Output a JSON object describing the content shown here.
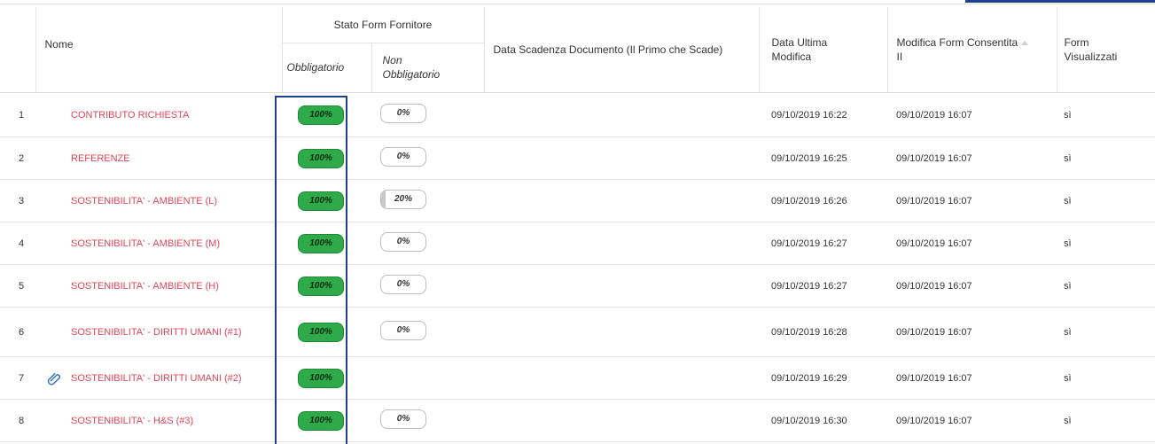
{
  "header": {
    "nome": "Nome",
    "stato_group": "Stato Form Fornitore",
    "obbligatorio": "Obbligatorio",
    "non_obbligatorio": "Non Obbligatorio",
    "data_scadenza": "Data Scadenza Documento (Il Primo che Scade)",
    "data_ultima": "Data Ultima Modifica",
    "modifica_consentita": "Modifica Form Consentita",
    "modifica_consentita_suffix": "II",
    "form_visualizzati": "Form Visualizzati"
  },
  "rows": [
    {
      "index": "1",
      "name": "CONTRIBUTO RICHIESTA",
      "obbligatorio": "100%",
      "obbligatorio_pct": 100,
      "non_obbligatorio": "0%",
      "non_obbligatorio_pct": 0,
      "scadenza": "",
      "ultima_modifica": "09/10/2019 16:22",
      "modifica_consentita": "09/10/2019 16:07",
      "visualizzati": "sì",
      "icon": ""
    },
    {
      "index": "2",
      "name": "REFERENZE",
      "obbligatorio": "100%",
      "obbligatorio_pct": 100,
      "non_obbligatorio": "0%",
      "non_obbligatorio_pct": 0,
      "scadenza": "",
      "ultima_modifica": "09/10/2019 16:25",
      "modifica_consentita": "09/10/2019 16:07",
      "visualizzati": "sì",
      "icon": ""
    },
    {
      "index": "3",
      "name": "SOSTENIBILITA' - AMBIENTE (L)",
      "obbligatorio": "100%",
      "obbligatorio_pct": 100,
      "non_obbligatorio": "20%",
      "non_obbligatorio_pct": 20,
      "scadenza": "",
      "ultima_modifica": "09/10/2019 16:26",
      "modifica_consentita": "09/10/2019 16:07",
      "visualizzati": "sì",
      "icon": ""
    },
    {
      "index": "4",
      "name": "SOSTENIBILITA' - AMBIENTE (M)",
      "obbligatorio": "100%",
      "obbligatorio_pct": 100,
      "non_obbligatorio": "0%",
      "non_obbligatorio_pct": 0,
      "scadenza": "",
      "ultima_modifica": "09/10/2019 16:27",
      "modifica_consentita": "09/10/2019 16:07",
      "visualizzati": "sì",
      "icon": ""
    },
    {
      "index": "5",
      "name": "SOSTENIBILITA' - AMBIENTE (H)",
      "obbligatorio": "100%",
      "obbligatorio_pct": 100,
      "non_obbligatorio": "0%",
      "non_obbligatorio_pct": 0,
      "scadenza": "",
      "ultima_modifica": "09/10/2019 16:27",
      "modifica_consentita": "09/10/2019 16:07",
      "visualizzati": "sì",
      "icon": ""
    },
    {
      "index": "6",
      "name": "SOSTENIBILITA' - DIRITTI UMANI (#1)",
      "obbligatorio": "100%",
      "obbligatorio_pct": 100,
      "non_obbligatorio": "0%",
      "non_obbligatorio_pct": 0,
      "scadenza": "",
      "ultima_modifica": "09/10/2019 16:28",
      "modifica_consentita": "09/10/2019 16:07",
      "visualizzati": "sì",
      "icon": ""
    },
    {
      "index": "7",
      "name": "SOSTENIBILITA' - DIRITTI UMANI (#2)",
      "obbligatorio": "100%",
      "obbligatorio_pct": 100,
      "non_obbligatorio": "",
      "non_obbligatorio_pct": null,
      "scadenza": "",
      "ultima_modifica": "09/10/2019 16:29",
      "modifica_consentita": "09/10/2019 16:07",
      "visualizzati": "sì",
      "icon": "attachment-icon"
    },
    {
      "index": "8",
      "name": "SOSTENIBILITA' - H&S (#3)",
      "obbligatorio": "100%",
      "obbligatorio_pct": 100,
      "non_obbligatorio": "0%",
      "non_obbligatorio_pct": 0,
      "scadenza": "",
      "ultima_modifica": "09/10/2019 16:30",
      "modifica_consentita": "09/10/2019 16:07",
      "visualizzati": "sì",
      "icon": ""
    }
  ],
  "colors": {
    "name_link": "#e0455a",
    "pill_full": "#2eaa4a",
    "highlight": "#1f3f8f"
  }
}
